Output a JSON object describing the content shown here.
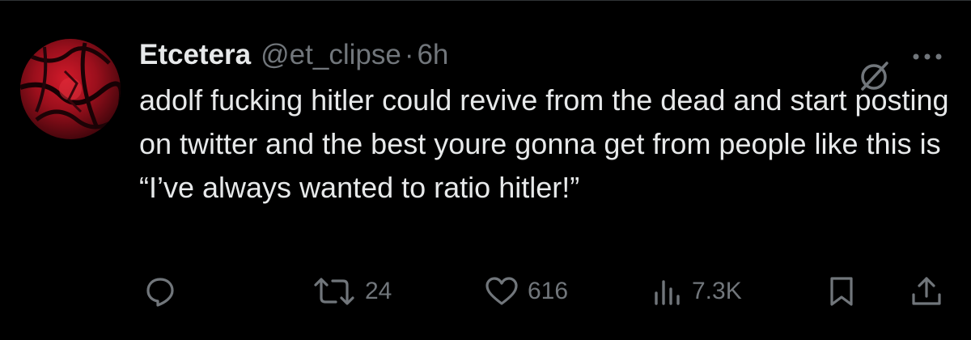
{
  "tweet": {
    "display_name": "Etcetera",
    "handle": "@et_clipse",
    "separator": "·",
    "time": "6h",
    "text": "adolf fucking hitler could revive from the dead and start posting on twitter and the best youre gonna get from people like this is “I’ve always wanted to ratio hitler!”",
    "avatar": "avatar-image",
    "grok_icon": "grok-icon",
    "more_icon": "more-icon"
  },
  "actions": {
    "reply": {
      "icon": "reply-icon"
    },
    "retweet": {
      "icon": "retweet-icon",
      "count": "24"
    },
    "like": {
      "icon": "like-icon",
      "count": "616"
    },
    "views": {
      "icon": "views-icon",
      "count": "7.3K"
    },
    "bookmark": {
      "icon": "bookmark-icon"
    },
    "share": {
      "icon": "share-icon"
    }
  },
  "colors": {
    "background": "#000000",
    "text_primary": "#e7e9ea",
    "text_secondary": "#71767b",
    "divider": "#2f3336"
  }
}
